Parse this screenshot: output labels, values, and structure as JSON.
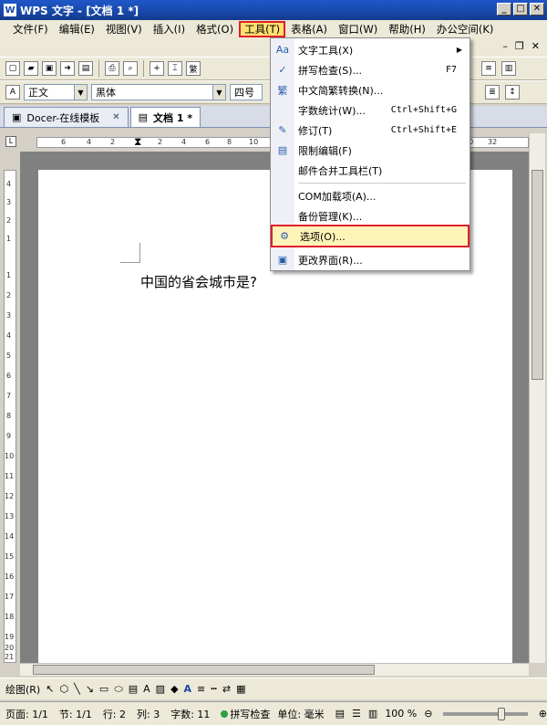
{
  "window": {
    "title": "WPS 文字 - [文档 1 *]",
    "app_icon": "W"
  },
  "menubar": {
    "items": [
      "文件(F)",
      "编辑(E)",
      "视图(V)",
      "插入(I)",
      "格式(O)",
      "工具(T)",
      "表格(A)",
      "窗口(W)",
      "帮助(H)",
      "办公空间(K)"
    ],
    "active_index": 5
  },
  "toolbar2": {
    "style_value": "正文",
    "font_value": "黑体",
    "size_value": "四号"
  },
  "tabs": [
    {
      "label": "Docer-在线模板"
    },
    {
      "label": "文档 1 *"
    }
  ],
  "ruler": {
    "numbers": [
      "6",
      "4",
      "2",
      "2",
      "4",
      "6",
      "8",
      "10",
      "12",
      "30",
      "32"
    ]
  },
  "vruler": {
    "numbers": [
      "4",
      "3",
      "2",
      "1",
      "1",
      "2",
      "3",
      "4",
      "5",
      "6",
      "7",
      "8",
      "9",
      "10",
      "11",
      "12",
      "13",
      "14",
      "15",
      "16",
      "17",
      "18",
      "19",
      "20",
      "21"
    ]
  },
  "document": {
    "text": "中国的省会城市是?"
  },
  "tools_menu": {
    "items": [
      {
        "label": "文字工具(X)",
        "shortcut": "",
        "submenu": true,
        "icon": "text-tool-icon"
      },
      {
        "label": "拼写检查(S)...",
        "shortcut": "F7",
        "icon": "spellcheck-icon"
      },
      {
        "label": "中文简繁转换(N)...",
        "shortcut": "",
        "icon": "convert-icon"
      },
      {
        "label": "字数统计(W)...",
        "shortcut": "Ctrl+Shift+G",
        "icon": ""
      },
      {
        "label": "修订(T)",
        "shortcut": "Ctrl+Shift+E",
        "icon": "revision-icon"
      },
      {
        "label": "限制编辑(F)",
        "shortcut": "",
        "icon": "restrict-icon"
      },
      {
        "label": "邮件合并工具栏(T)",
        "shortcut": "",
        "icon": ""
      },
      {
        "label": "COM加载项(A)...",
        "shortcut": "",
        "icon": ""
      },
      {
        "label": "备份管理(K)...",
        "shortcut": "",
        "icon": ""
      },
      {
        "label": "选项(O)...",
        "shortcut": "",
        "icon": "gear-icon",
        "highlighted": true
      },
      {
        "label": "更改界面(R)...",
        "shortcut": "",
        "icon": "ui-icon"
      }
    ]
  },
  "drawbar": {
    "draw_label": "绘图(R)"
  },
  "statusbar": {
    "page": "页面: 1/1",
    "section": "节: 1/1",
    "line": "行: 2",
    "column": "列: 3",
    "wordcount": "字数: 11",
    "spellcheck": "拼写检查",
    "unit": "单位: 毫米",
    "zoom": "100 %"
  },
  "colors": {
    "highlight_border": "#e0202a",
    "titlebar": "#1848a8"
  }
}
